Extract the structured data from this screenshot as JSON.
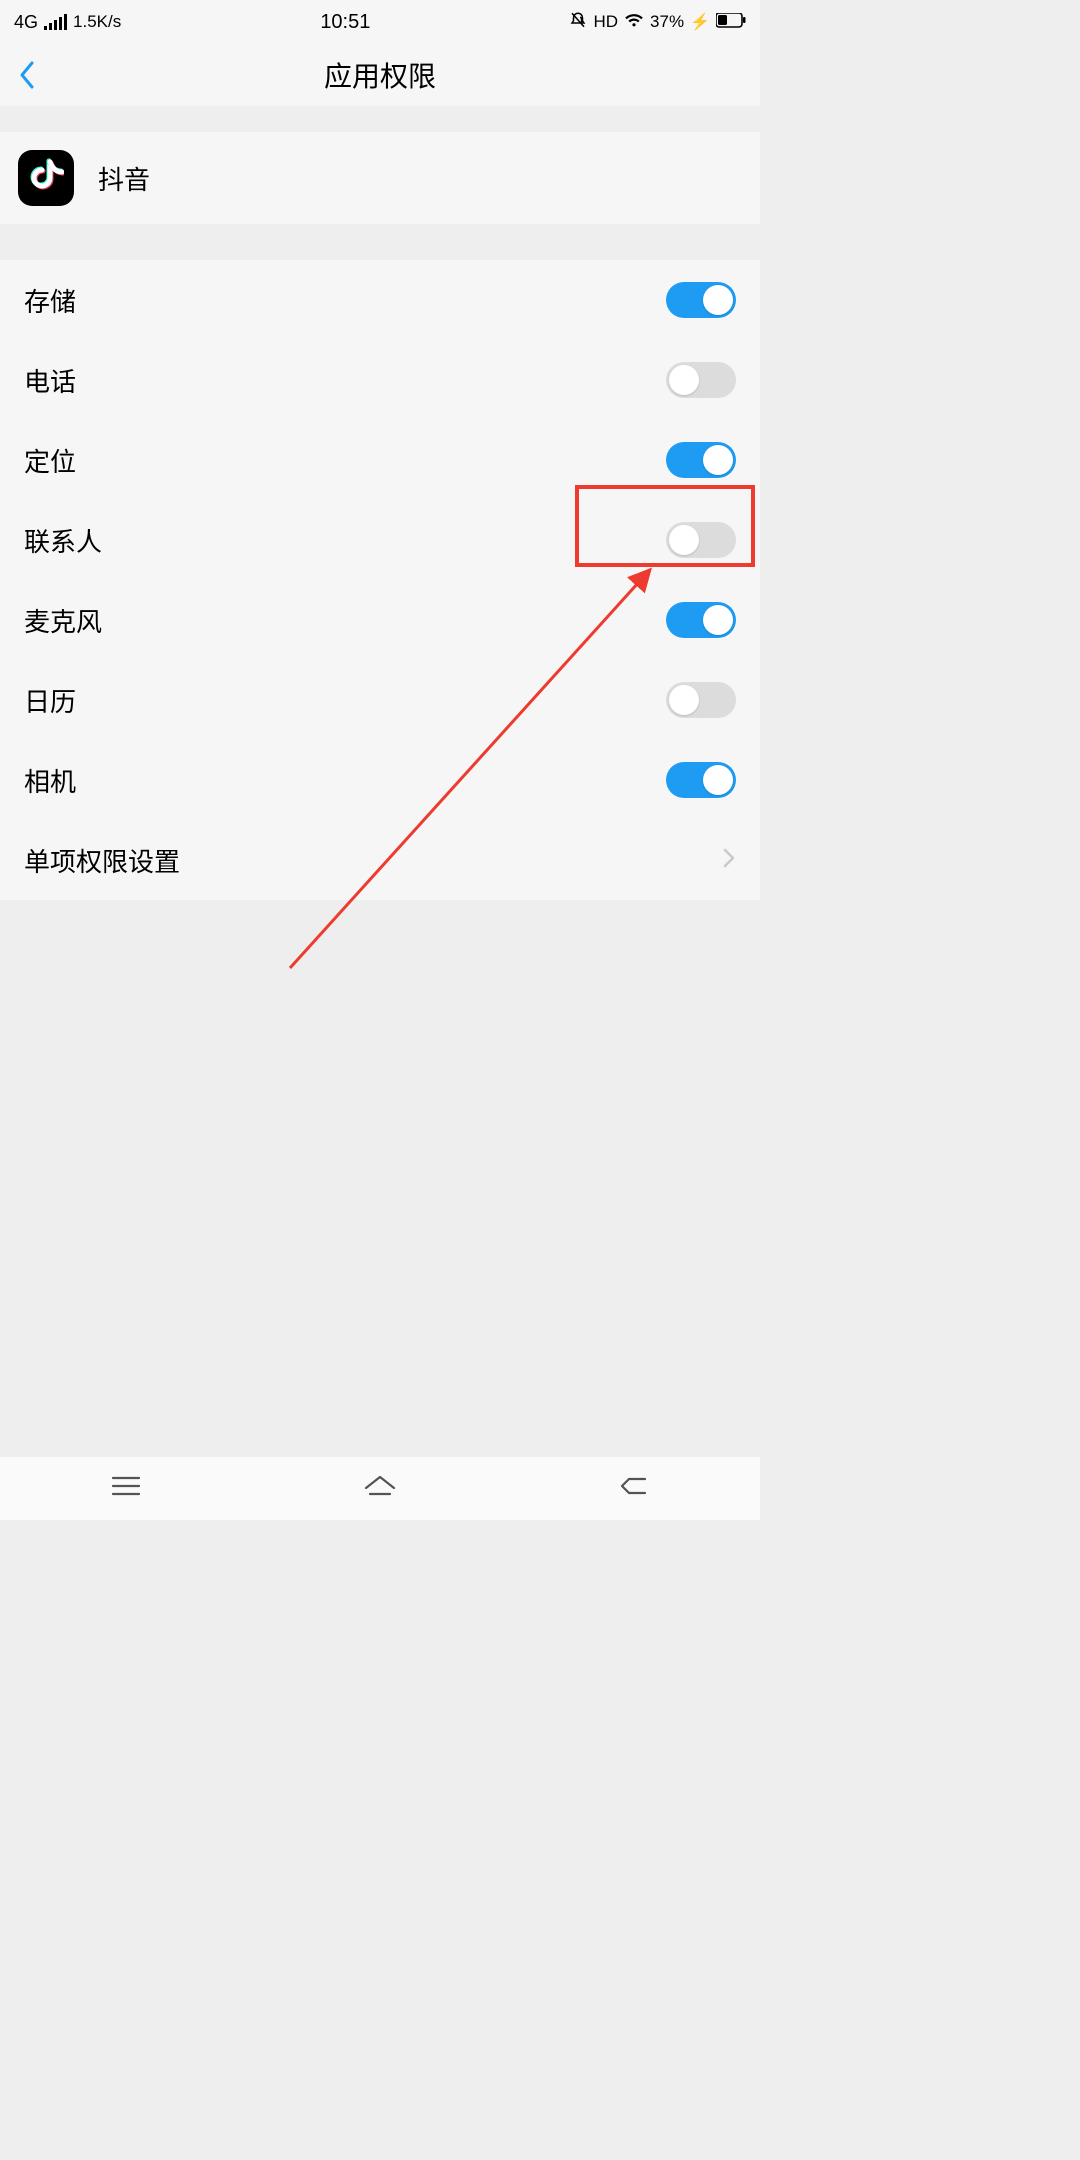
{
  "status": {
    "network": "4G",
    "speed": "1.5K/s",
    "time": "10:51",
    "hd": "HD",
    "battery_pct": "37%"
  },
  "header": {
    "title": "应用权限"
  },
  "app": {
    "name": "抖音"
  },
  "perms": [
    {
      "label": "存储",
      "on": true
    },
    {
      "label": "电话",
      "on": false
    },
    {
      "label": "定位",
      "on": true
    },
    {
      "label": "联系人",
      "on": false
    },
    {
      "label": "麦克风",
      "on": true
    },
    {
      "label": "日历",
      "on": false
    },
    {
      "label": "相机",
      "on": true
    }
  ],
  "extra": {
    "single_perm": "单项权限设置"
  },
  "annotation": {
    "highlight_index": 3
  }
}
